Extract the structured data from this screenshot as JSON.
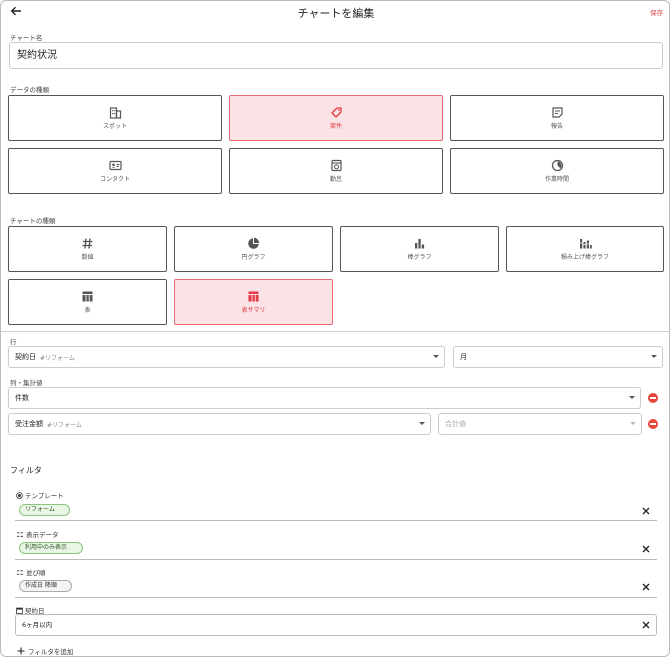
{
  "header": {
    "title": "チャートを編集",
    "save_label": "保存"
  },
  "chart_name": {
    "label": "チャート名",
    "value": "契約状況"
  },
  "data_type": {
    "label": "データの種類",
    "options": [
      {
        "label": "スポット",
        "icon": "building-icon",
        "selected": false
      },
      {
        "label": "案件",
        "icon": "tag-icon",
        "selected": true
      },
      {
        "label": "報告",
        "icon": "report-icon",
        "selected": false
      },
      {
        "label": "コンタクト",
        "icon": "contact-card-icon",
        "selected": false
      },
      {
        "label": "勤怠",
        "icon": "timeclock-icon",
        "selected": false
      },
      {
        "label": "作業時間",
        "icon": "work-time-icon",
        "selected": false
      }
    ]
  },
  "chart_type": {
    "label": "チャートの種類",
    "options": [
      {
        "label": "数値",
        "icon": "hash-icon",
        "selected": false
      },
      {
        "label": "円グラフ",
        "icon": "pie-chart-icon",
        "selected": false
      },
      {
        "label": "棒グラフ",
        "icon": "bar-chart-icon",
        "selected": false
      },
      {
        "label": "積み上げ棒グラフ",
        "icon": "stacked-bar-icon",
        "selected": false
      },
      {
        "label": "表",
        "icon": "table-icon",
        "selected": false
      },
      {
        "label": "表サマリ",
        "icon": "table-summary-icon",
        "selected": true
      }
    ]
  },
  "rows": {
    "label": "行",
    "field": {
      "value": "契約日",
      "sub": "#リフォーム"
    },
    "unit": {
      "value": "月"
    }
  },
  "columns": {
    "label": "列・集計値",
    "items": [
      {
        "value": "件数",
        "sub": ""
      },
      {
        "value": "受注金額",
        "sub": "#リフォーム",
        "aggregate_placeholder": "合計値"
      }
    ]
  },
  "filters": {
    "title": "フィルタ",
    "items": [
      {
        "label": "テンプレート",
        "icon": "radio-icon",
        "chip": "リフォーム"
      },
      {
        "label": "表示データ",
        "icon": "sort-icon",
        "chip": "利用中のみ表示"
      },
      {
        "label": "並び順",
        "icon": "sort-icon",
        "chip": "作成日 降順"
      },
      {
        "label": "契約日",
        "icon": "calendar-icon",
        "value": "6ヶ月以内"
      }
    ],
    "add_label": "フィルタを追加"
  },
  "colors": {
    "accent": "#e23b45",
    "selected_bg": "#fbe2e4",
    "chip_green": "#8cc47e",
    "remove": "#e8453c"
  }
}
